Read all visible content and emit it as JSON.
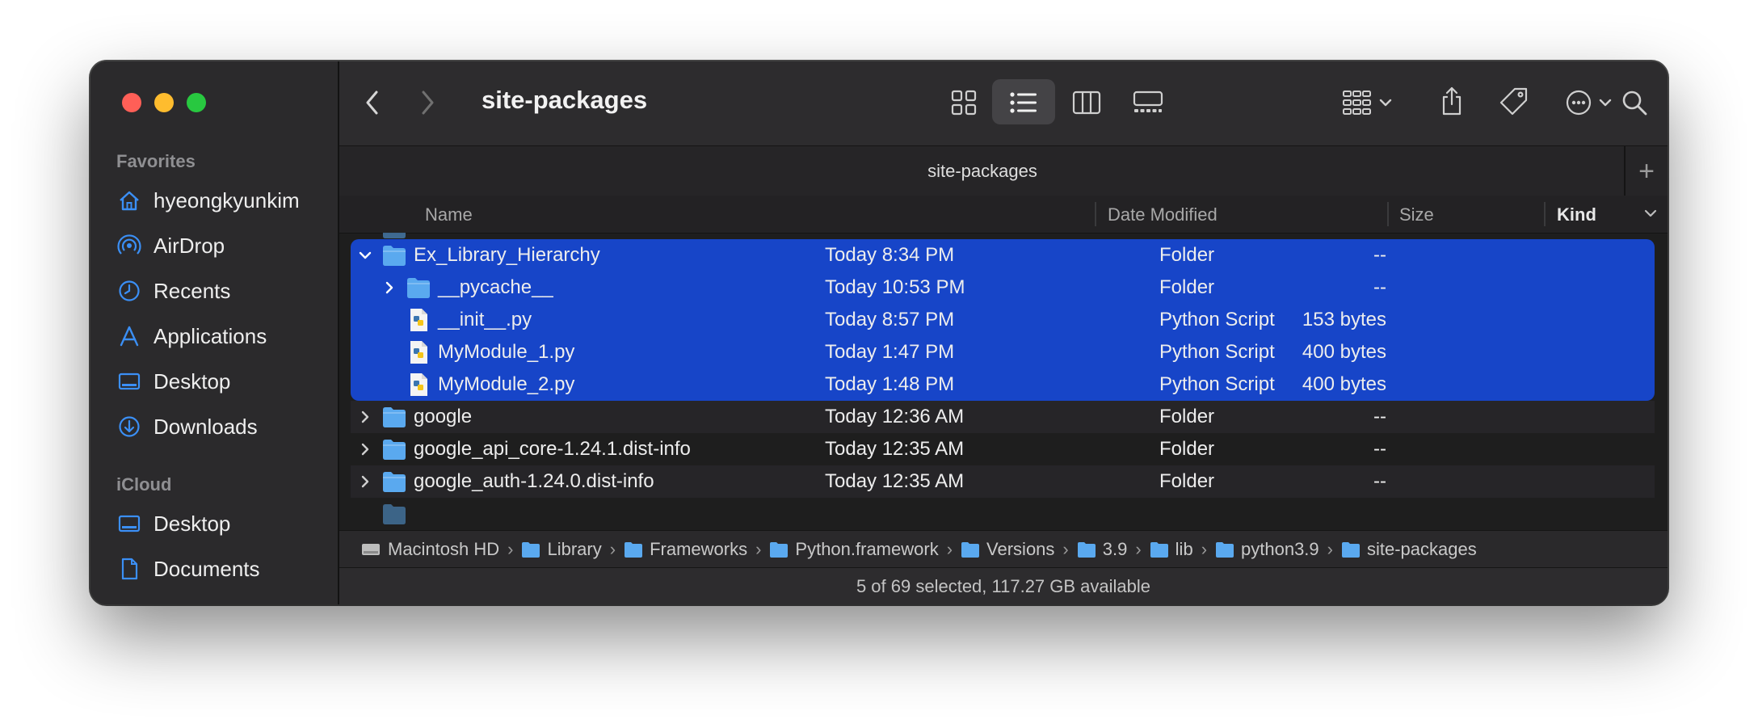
{
  "window": {
    "title": "site-packages",
    "tab_title": "site-packages",
    "tab_add_label": "+"
  },
  "sidebar": {
    "favorites_heading": "Favorites",
    "favorites": [
      {
        "label": "hyeongkyunkim",
        "icon": "home-icon"
      },
      {
        "label": "AirDrop",
        "icon": "airdrop-icon"
      },
      {
        "label": "Recents",
        "icon": "clock-icon"
      },
      {
        "label": "Applications",
        "icon": "applications-icon"
      },
      {
        "label": "Desktop",
        "icon": "desktop-icon"
      },
      {
        "label": "Downloads",
        "icon": "downloads-icon"
      }
    ],
    "icloud_heading": "iCloud",
    "icloud": [
      {
        "label": "Desktop",
        "icon": "desktop-icon"
      },
      {
        "label": "Documents",
        "icon": "document-icon"
      }
    ]
  },
  "columns": {
    "name": "Name",
    "date": "Date Modified",
    "size": "Size",
    "kind": "Kind"
  },
  "rows": [
    {
      "name": "Ex_Library_Hierarchy",
      "date": "Today 8:34 PM",
      "size": "--",
      "kind": "Folder",
      "type": "folder",
      "expanded": true,
      "selected": true,
      "indent": 0
    },
    {
      "name": "__pycache__",
      "date": "Today 10:53 PM",
      "size": "--",
      "kind": "Folder",
      "type": "folder",
      "expanded": false,
      "selected": true,
      "indent": 1
    },
    {
      "name": "__init__.py",
      "date": "Today 8:57 PM",
      "size": "153 bytes",
      "kind": "Python Script",
      "type": "python",
      "selected": true,
      "indent": 1
    },
    {
      "name": "MyModule_1.py",
      "date": "Today 1:47 PM",
      "size": "400 bytes",
      "kind": "Python Script",
      "type": "python",
      "selected": true,
      "indent": 1
    },
    {
      "name": "MyModule_2.py",
      "date": "Today 1:48 PM",
      "size": "400 bytes",
      "kind": "Python Script",
      "type": "python",
      "selected": true,
      "indent": 1
    },
    {
      "name": "google",
      "date": "Today 12:36 AM",
      "size": "--",
      "kind": "Folder",
      "type": "folder",
      "expanded": false,
      "selected": false,
      "indent": 0
    },
    {
      "name": "google_api_core-1.24.1.dist-info",
      "date": "Today 12:35 AM",
      "size": "--",
      "kind": "Folder",
      "type": "folder",
      "expanded": false,
      "selected": false,
      "indent": 0
    },
    {
      "name": "google_auth-1.24.0.dist-info",
      "date": "Today 12:35 AM",
      "size": "--",
      "kind": "Folder",
      "type": "folder",
      "expanded": false,
      "selected": false,
      "indent": 0
    }
  ],
  "path": [
    {
      "label": "Macintosh HD",
      "icon": "disk-icon"
    },
    {
      "label": "Library",
      "icon": "folder-icon"
    },
    {
      "label": "Frameworks",
      "icon": "folder-icon"
    },
    {
      "label": "Python.framework",
      "icon": "folder-icon"
    },
    {
      "label": "Versions",
      "icon": "folder-icon"
    },
    {
      "label": "3.9",
      "icon": "folder-icon"
    },
    {
      "label": "lib",
      "icon": "folder-icon"
    },
    {
      "label": "python3.9",
      "icon": "folder-icon"
    },
    {
      "label": "site-packages",
      "icon": "folder-icon"
    }
  ],
  "status": "5 of 69 selected, 117.27 GB available",
  "colors": {
    "selection": "#1745c8",
    "accent": "#3b8ff5",
    "folder": "#5aa9ef"
  }
}
